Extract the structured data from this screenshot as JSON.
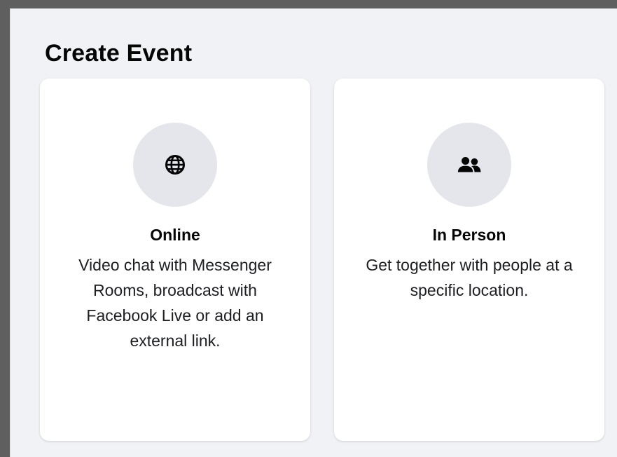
{
  "dialog": {
    "title": "Create Event"
  },
  "options": [
    {
      "title": "Online",
      "description": "Video chat with Messenger Rooms, broadcast with Facebook Live or add an external link.",
      "icon": "globe-icon"
    },
    {
      "title": "In Person",
      "description": "Get together with people at a specific location.",
      "icon": "people-icon"
    }
  ],
  "colors": {
    "background": "#f0f2f5",
    "card": "#ffffff",
    "icon_circle": "#e4e6eb",
    "text": "#050505"
  }
}
